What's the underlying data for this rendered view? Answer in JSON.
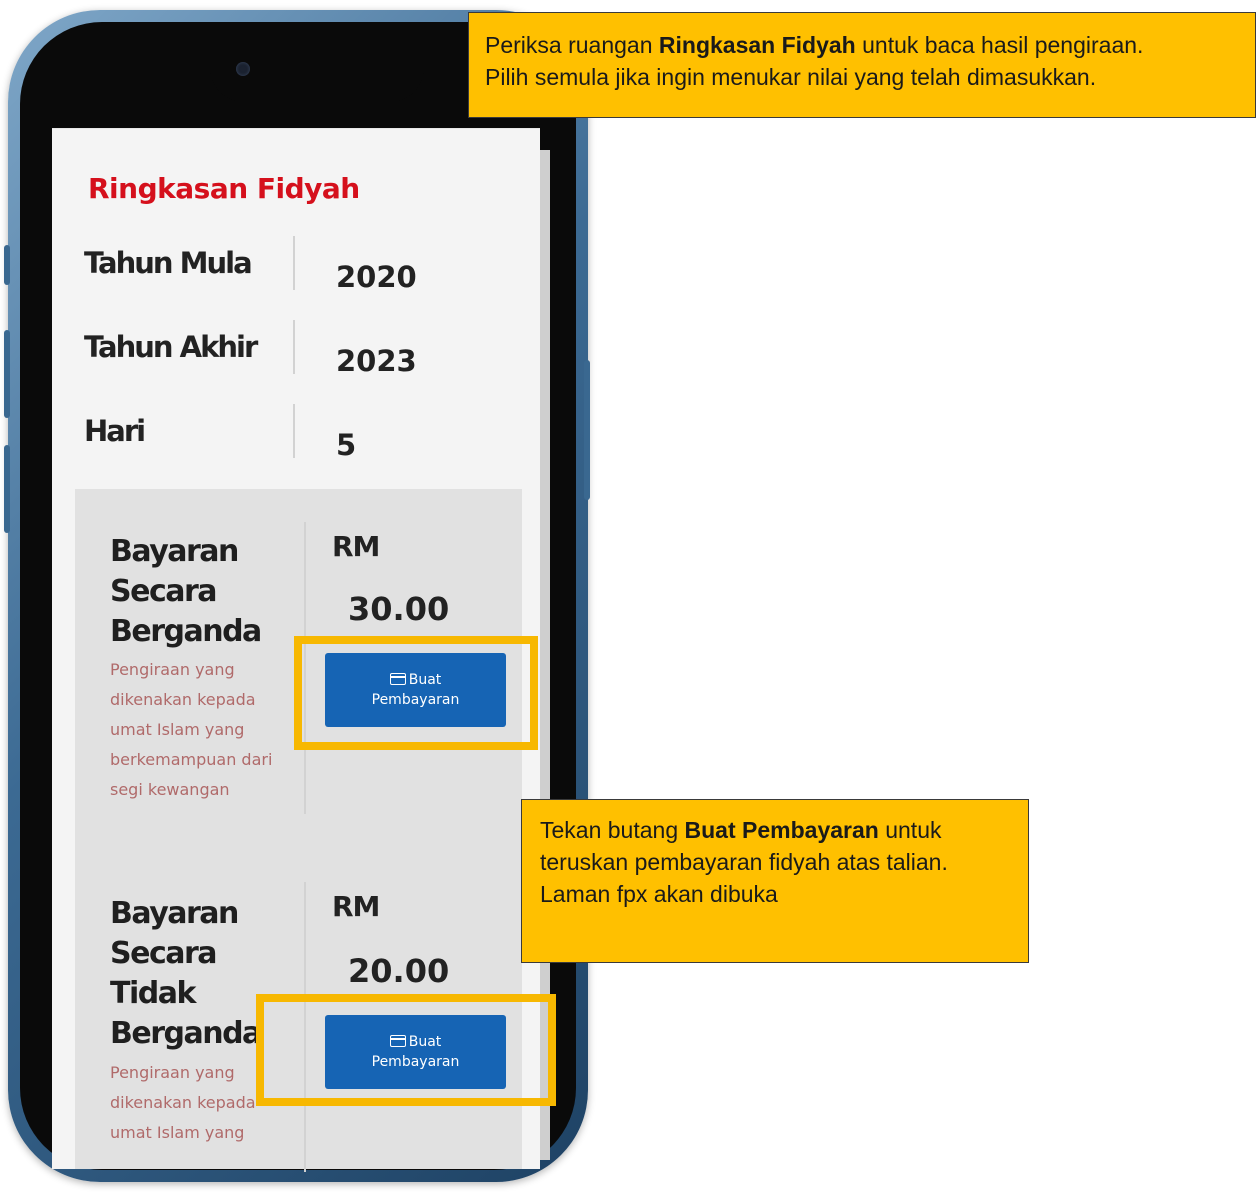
{
  "summary": {
    "title": "Ringkasan Fidyah",
    "rows": [
      {
        "label": "Tahun Mula",
        "value": "2020"
      },
      {
        "label": "Tahun Akhir",
        "value": "2023"
      },
      {
        "label": "Hari",
        "value": "5"
      }
    ]
  },
  "payments": [
    {
      "title": "Bayaran Secara Berganda",
      "description": "Pengiraan yang dikenakan kepada umat Islam yang berkemampuan dari segi kewangan",
      "currency": "RM",
      "amount": "30.00",
      "button_line1": "Buat",
      "button_line2": "Pembayaran"
    },
    {
      "title": "Bayaran Secara Tidak Berganda",
      "description": "Pengiraan yang dikenakan kepada umat Islam yang",
      "currency": "RM",
      "amount": "20.00",
      "button_line1": "Buat",
      "button_line2": "Pembayaran"
    }
  ],
  "callouts": {
    "top": {
      "line1_pre": "Periksa ruangan ",
      "line1_bold": "Ringkasan Fidyah",
      "line1_post": " untuk baca hasil pengiraan.",
      "line2": "Pilih semula jika ingin menukar nilai yang telah dimasukkan."
    },
    "middle": {
      "line1_pre": "Tekan butang ",
      "line1_bold": "Buat Pembayaran",
      "line1_post": " untuk",
      "line2": "teruskan pembayaran fidyah atas talian.",
      "line3": "Laman fpx akan dibuka"
    }
  },
  "colors": {
    "title_red": "#d5101c",
    "button_blue": "#1664b4",
    "highlight_yellow": "#f7b801",
    "callout_bg": "#ffc000"
  },
  "icons": {
    "button_icon": "credit-card-icon"
  }
}
